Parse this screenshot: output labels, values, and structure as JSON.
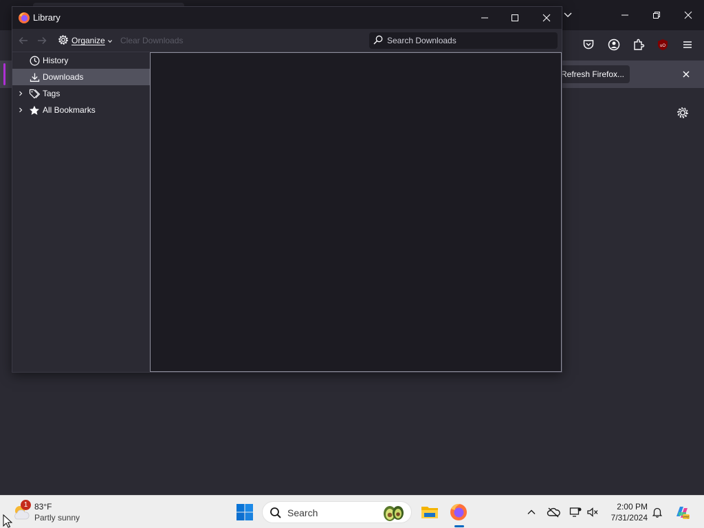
{
  "library": {
    "title": "Library",
    "toolbar": {
      "organize_label": "Organize",
      "clear_label": "Clear Downloads",
      "search_placeholder": "Search Downloads"
    },
    "sidebar": {
      "items": [
        {
          "label": "History",
          "icon": "clock-icon",
          "selected": false,
          "expandable": false
        },
        {
          "label": "Downloads",
          "icon": "download-icon",
          "selected": true,
          "expandable": false
        },
        {
          "label": "Tags",
          "icon": "tag-icon",
          "selected": false,
          "expandable": true
        },
        {
          "label": "All Bookmarks",
          "icon": "star-icon",
          "selected": false,
          "expandable": true
        }
      ]
    }
  },
  "firefox": {
    "notification_button": "Refresh Firefox..."
  },
  "taskbar": {
    "weather": {
      "temp": "83°F",
      "condition": "Partly sunny",
      "badge": "1"
    },
    "search_label": "Search",
    "clock": {
      "time": "2:00 PM",
      "date": "7/31/2024"
    }
  },
  "colors": {
    "dark_bg": "#1c1b22",
    "panel_bg": "#2b2a33",
    "selection": "#52525e",
    "accent": "#0067c0"
  }
}
